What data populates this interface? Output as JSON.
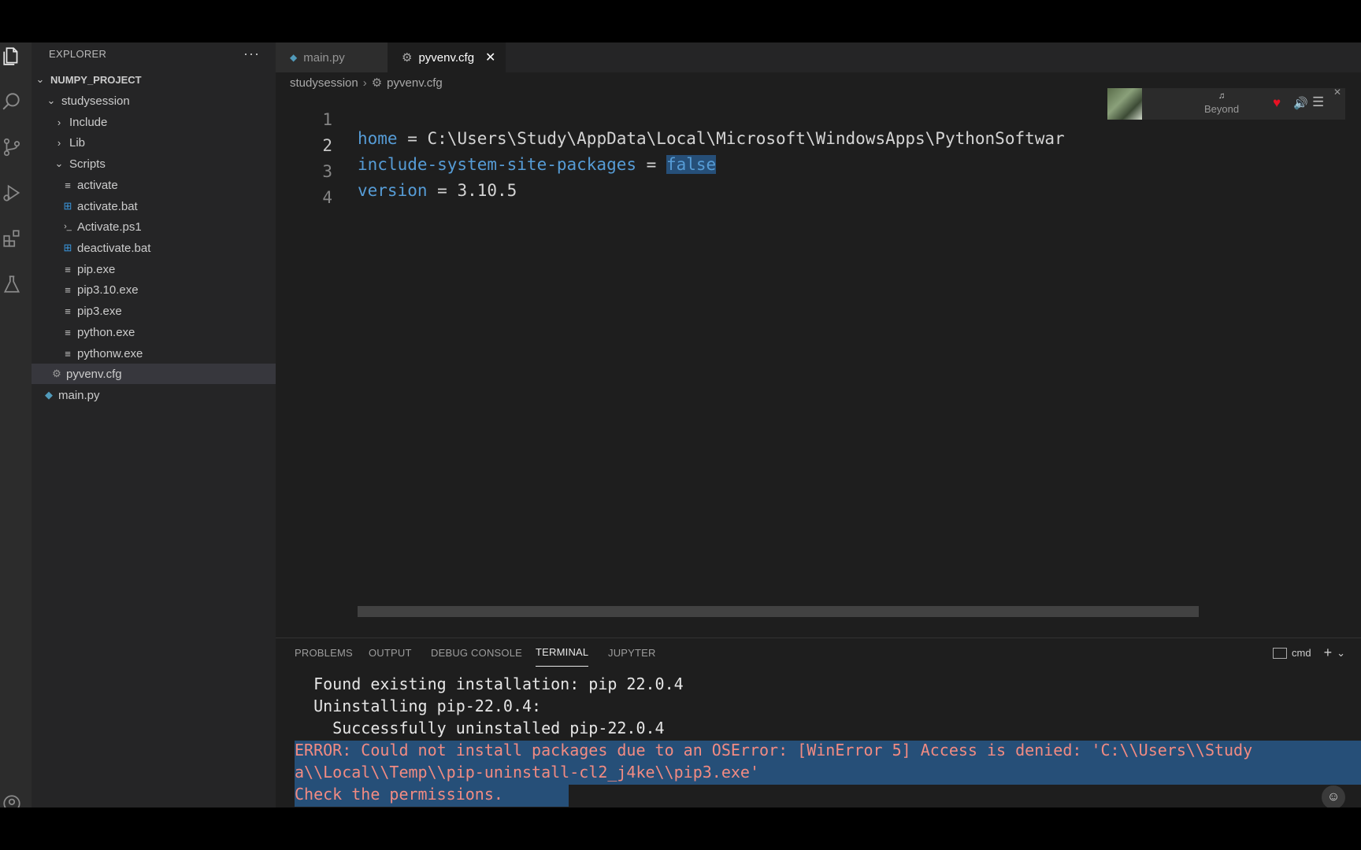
{
  "sidebar": {
    "header": "EXPLORER",
    "more": "···",
    "items": [
      {
        "label": "NUMPY_PROJECT",
        "chev": "⌄",
        "icon": ""
      },
      {
        "label": "studysession",
        "chev": "⌄",
        "icon": ""
      },
      {
        "label": "Include",
        "chev": "›",
        "icon": ""
      },
      {
        "label": "Lib",
        "chev": "›",
        "icon": ""
      },
      {
        "label": "Scripts",
        "chev": "⌄",
        "icon": ""
      },
      {
        "label": "activate",
        "chev": "",
        "icon": "≡"
      },
      {
        "label": "activate.bat",
        "chev": "",
        "icon": "⊞"
      },
      {
        "label": "Activate.ps1",
        "chev": "",
        "icon": "›_"
      },
      {
        "label": "deactivate.bat",
        "chev": "",
        "icon": "⊞"
      },
      {
        "label": "pip.exe",
        "chev": "",
        "icon": "≡"
      },
      {
        "label": "pip3.10.exe",
        "chev": "",
        "icon": "≡"
      },
      {
        "label": "pip3.exe",
        "chev": "",
        "icon": "≡"
      },
      {
        "label": "python.exe",
        "chev": "",
        "icon": "≡"
      },
      {
        "label": "pythonw.exe",
        "chev": "",
        "icon": "≡"
      },
      {
        "label": "pyvenv.cfg",
        "chev": "",
        "icon": "⚙"
      },
      {
        "label": "main.py",
        "chev": "",
        "icon": "◆"
      }
    ]
  },
  "tabs": [
    {
      "label": "main.py",
      "icon": "◆"
    },
    {
      "label": "pyvenv.cfg",
      "icon": "⚙",
      "close": "✕"
    }
  ],
  "breadcrumb": {
    "folder": "studysession",
    "sep": "›",
    "file": "pyvenv.cfg",
    "file_icon": "⚙"
  },
  "editor": {
    "lines": [
      {
        "num": "1",
        "key": "home",
        "op": " = ",
        "val": "C:\\Users\\Study\\AppData\\Local\\Microsoft\\WindowsApps\\PythonSoftwar"
      },
      {
        "num": "2",
        "key": "include-system-site-packages",
        "op": " = ",
        "val": "false"
      },
      {
        "num": "3",
        "key": "version",
        "op": " = ",
        "val": "3.10.5"
      },
      {
        "num": "4",
        "key": "",
        "op": "",
        "val": ""
      }
    ]
  },
  "media": {
    "title": "Beyond",
    "note": "♫",
    "heart": "♥",
    "volume": "🔊",
    "menu": "☰",
    "close": "✕"
  },
  "panel": {
    "tabs": [
      "PROBLEMS",
      "OUTPUT",
      "DEBUG CONSOLE",
      "TERMINAL",
      "JUPYTER"
    ],
    "shell": "cmd",
    "add": "+",
    "dropdown": "⌄"
  },
  "terminal": {
    "lines": [
      "  Found existing installation: pip 22.0.4",
      "  Uninstalling pip-22.0.4:",
      "    Successfully uninstalled pip-22.0.4",
      "ERROR: Could not install packages due to an OSError: [WinError 5] Access is denied: 'C:\\\\Users\\\\Study",
      "a\\\\Local\\\\Temp\\\\pip-uninstall-cl2_j4ke\\\\pip3.exe'",
      "Check the permissions."
    ]
  },
  "colors": {
    "selection": "#264f78",
    "keyword": "#569cd6",
    "error_text": "#f28b82",
    "heart": "#e81123"
  }
}
